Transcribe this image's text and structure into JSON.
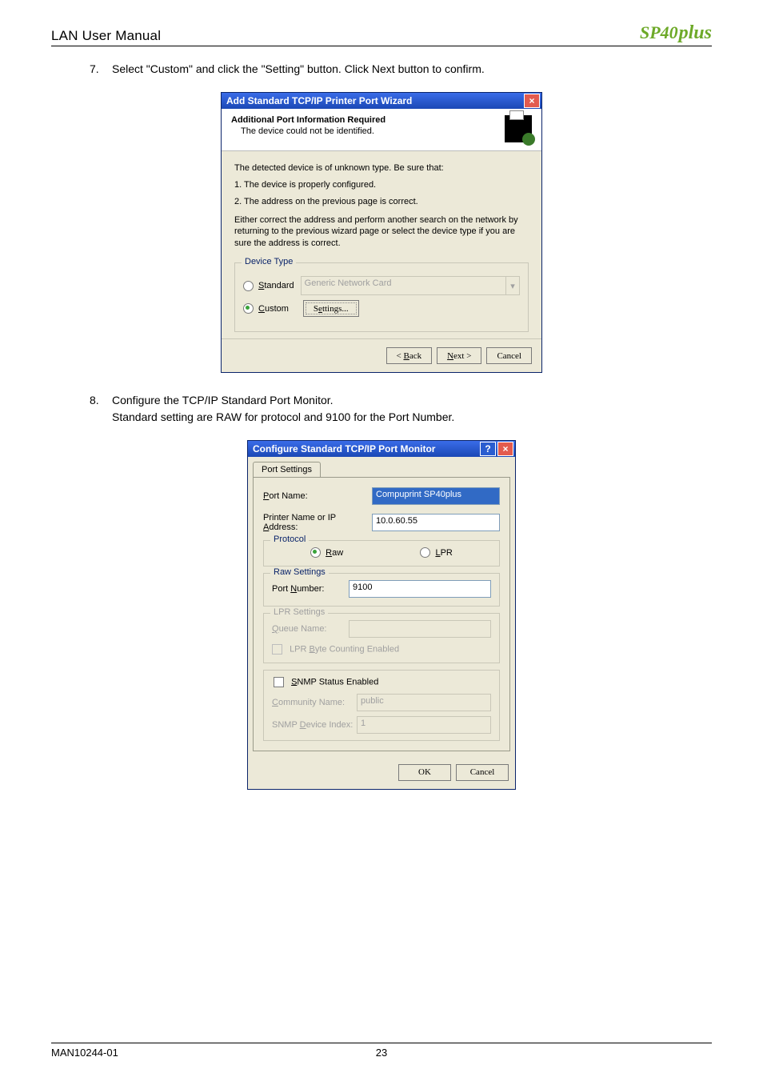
{
  "page": {
    "header_title": "LAN User Manual",
    "logo_base": "SP40",
    "logo_suffix": "plus",
    "footer_left": "MAN10244-01",
    "footer_center": "23"
  },
  "step7": {
    "num": "7.",
    "text": "Select \"Custom\" and click the \"Setting\"  button.  Click  Next button to confirm."
  },
  "step8": {
    "num": "8.",
    "line1": "Configure the TCP/IP Standard Port Monitor.",
    "line2": "Standard setting are RAW for protocol and 9100 for the Port Number."
  },
  "dialog1": {
    "title": "Add Standard TCP/IP Printer Port Wizard",
    "head_h1": "Additional Port Information Required",
    "head_h2": "The device could not be identified.",
    "p1": "The detected device is of unknown type.  Be sure that:",
    "p2": "1.  The device is properly configured.",
    "p3": "2.  The address on the previous page is correct.",
    "p4": "Either correct the address and perform another search on the network by returning to the previous wizard page or select the device type if you are sure the address is correct.",
    "group_legend": "Device Type",
    "radio_standard": "Standard",
    "standard_value": "Generic Network Card",
    "radio_custom": "Custom",
    "settings_btn": "Settings...",
    "btn_back": "< Back",
    "btn_next": "Next >",
    "btn_cancel": "Cancel"
  },
  "dialog2": {
    "title": "Configure Standard TCP/IP Port Monitor",
    "tab": "Port Settings",
    "port_name_lbl": "Port Name:",
    "port_name_val": "Compuprint SP40plus",
    "printer_addr_lbl": "Printer Name or IP Address:",
    "printer_addr_val": "10.0.60.55",
    "protocol_legend": "Protocol",
    "raw_label": "Raw",
    "lpr_label": "LPR",
    "raw_settings_legend": "Raw Settings",
    "port_number_lbl": "Port Number:",
    "port_number_val": "9100",
    "lpr_settings_legend": "LPR Settings",
    "queue_name_lbl": "Queue Name:",
    "queue_name_val": "",
    "lpr_byte_lbl": "LPR Byte Counting Enabled",
    "snmp_status_lbl": "SNMP Status Enabled",
    "community_lbl": "Community Name:",
    "community_val": "public",
    "snmp_idx_lbl": "SNMP Device Index:",
    "snmp_idx_val": "1",
    "btn_ok": "OK",
    "btn_cancel": "Cancel"
  }
}
